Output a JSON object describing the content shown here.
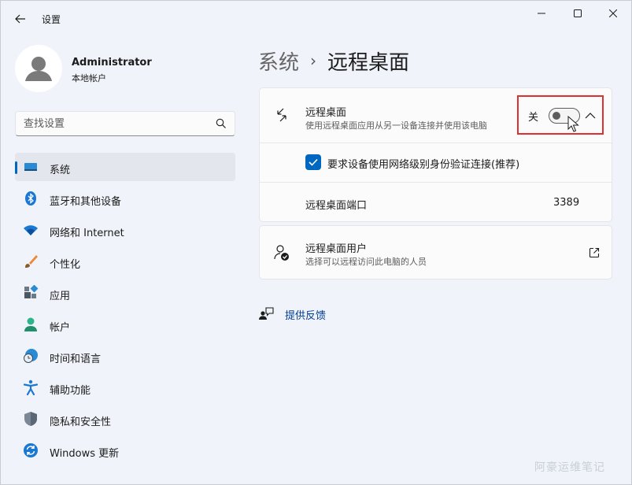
{
  "app": {
    "title": "设置"
  },
  "user": {
    "name": "Administrator",
    "account_type": "本地帐户"
  },
  "search": {
    "placeholder": "查找设置",
    "value": ""
  },
  "sidebar": {
    "items": [
      {
        "label": "系统",
        "icon": "system-display-icon",
        "active": true
      },
      {
        "label": "蓝牙和其他设备",
        "icon": "bluetooth-icon"
      },
      {
        "label": "网络和 Internet",
        "icon": "wifi-icon"
      },
      {
        "label": "个性化",
        "icon": "brush-icon"
      },
      {
        "label": "应用",
        "icon": "apps-icon"
      },
      {
        "label": "帐户",
        "icon": "account-icon"
      },
      {
        "label": "时间和语言",
        "icon": "globe-clock-icon"
      },
      {
        "label": "辅助功能",
        "icon": "accessibility-icon"
      },
      {
        "label": "隐私和安全性",
        "icon": "shield-icon"
      },
      {
        "label": "Windows 更新",
        "icon": "update-icon"
      }
    ]
  },
  "breadcrumb": {
    "parent": "系统",
    "separator": "›",
    "current": "远程桌面"
  },
  "remote_desktop": {
    "title": "远程桌面",
    "description": "使用远程桌面应用从另一设备连接并使用该电脑",
    "toggle_state_label": "关",
    "enabled": false,
    "nla_label": "要求设备使用网络级别身份验证连接(推荐)",
    "nla_checked": true,
    "port_label": "远程桌面端口",
    "port_value": "3389"
  },
  "rd_users": {
    "title": "远程桌面用户",
    "description": "选择可以远程访问此电脑的人员"
  },
  "feedback": {
    "label": "提供反馈"
  },
  "watermark": {
    "text": "阿豪运维笔记"
  },
  "colors": {
    "accent": "#0067c0",
    "highlight_box": "#e0302d",
    "link": "#003e92"
  }
}
